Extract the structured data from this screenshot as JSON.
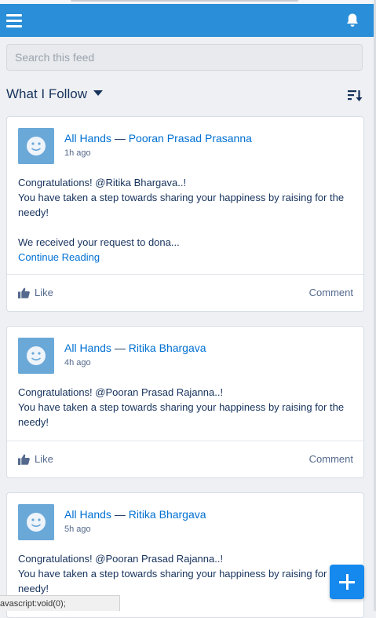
{
  "colors": {
    "header": "#2a8fd8",
    "link": "#0070d2",
    "fab": "#1589ee",
    "avatar": "#6aa8d8"
  },
  "header": {
    "menu_icon": "hamburger-menu-icon",
    "notifications_icon": "bell-icon"
  },
  "search": {
    "placeholder": "Search this feed",
    "value": ""
  },
  "filter": {
    "label": "What I Follow",
    "sort_icon": "sort-icon"
  },
  "posts": [
    {
      "group": "All Hands",
      "separator": "—",
      "author": "Pooran Prasad Prasanna",
      "time": "1h ago",
      "line1": "Congratulations! @Ritika Bhargava..!",
      "line2": "You have taken a step towards sharing your happiness by raising for the needy!",
      "line3": "We received your request to dona...",
      "more": "Continue Reading",
      "like": "Like",
      "comment": "Comment"
    },
    {
      "group": "All Hands",
      "separator": "—",
      "author": "Ritika Bhargava",
      "time": "4h ago",
      "line1": "Congratulations! @Pooran Prasad Rajanna..!",
      "line2": "You have taken a step towards sharing your happiness by raising for the needy!",
      "like": "Like",
      "comment": "Comment"
    },
    {
      "group": "All Hands",
      "separator": "—",
      "author": "Ritika Bhargava",
      "time": "5h ago",
      "line1": "Congratulations! @Pooran Prasad Rajanna..!",
      "line2": "You have taken a step towards sharing your happiness by raising for the needy!"
    }
  ],
  "status_bar": "avascript:void(0);",
  "fab_icon": "plus-icon"
}
